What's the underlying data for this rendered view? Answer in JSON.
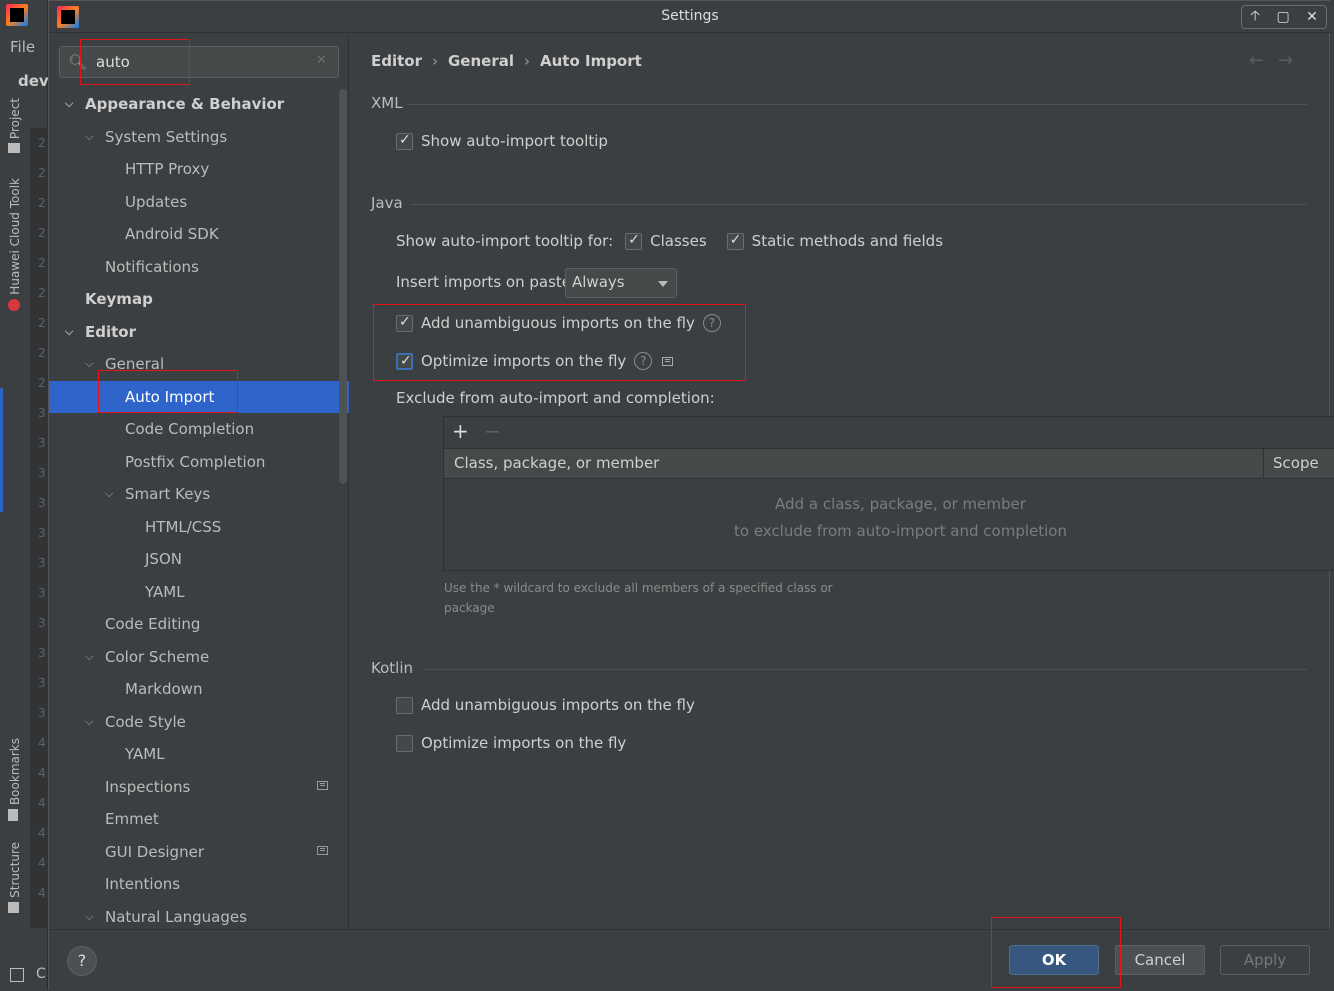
{
  "ide": {
    "menu_file": "File",
    "project_label": "devl",
    "side_tabs": [
      "Project",
      "Huawei Cloud Toolk",
      "Bookmarks",
      "Structure"
    ],
    "gutter_numbers": [
      "2",
      "2",
      "2",
      "2",
      "2",
      "2",
      "2",
      "2",
      "2",
      "3",
      "3",
      "3",
      "3",
      "3",
      "3",
      "3",
      "3",
      "3",
      "3",
      "3",
      "4",
      "4",
      "4",
      "4",
      "4",
      "4"
    ],
    "bottom_label": "C"
  },
  "dialog": {
    "title": "Settings",
    "window_controls": [
      "🡡",
      "▢",
      "✕"
    ]
  },
  "search": {
    "value": "auto",
    "clear": "✕"
  },
  "tree": [
    {
      "label": "Appearance & Behavior",
      "level": 0,
      "expanded": true,
      "bold": true
    },
    {
      "label": "System Settings",
      "level": 1,
      "expanded": true
    },
    {
      "label": "HTTP Proxy",
      "level": 2
    },
    {
      "label": "Updates",
      "level": 2
    },
    {
      "label": "Android SDK",
      "level": 2
    },
    {
      "label": "Notifications",
      "level": 1
    },
    {
      "label": "Keymap",
      "level": 0,
      "bold": true
    },
    {
      "label": "Editor",
      "level": 0,
      "expanded": true,
      "bold": true
    },
    {
      "label": "General",
      "level": 1,
      "expanded": true
    },
    {
      "label": "Auto Import",
      "level": 2,
      "selected": true
    },
    {
      "label": "Code Completion",
      "level": 2
    },
    {
      "label": "Postfix Completion",
      "level": 2
    },
    {
      "label": "Smart Keys",
      "level": 2,
      "expanded": true
    },
    {
      "label": "HTML/CSS",
      "level": 3
    },
    {
      "label": "JSON",
      "level": 3
    },
    {
      "label": "YAML",
      "level": 3
    },
    {
      "label": "Code Editing",
      "level": 1
    },
    {
      "label": "Color Scheme",
      "level": 1,
      "expanded": true
    },
    {
      "label": "Markdown",
      "level": 2
    },
    {
      "label": "Code Style",
      "level": 1,
      "expanded": true
    },
    {
      "label": "YAML",
      "level": 2
    },
    {
      "label": "Inspections",
      "level": 1,
      "modified": true
    },
    {
      "label": "Emmet",
      "level": 1
    },
    {
      "label": "GUI Designer",
      "level": 1,
      "modified": true
    },
    {
      "label": "Intentions",
      "level": 1
    },
    {
      "label": "Natural Languages",
      "level": 1,
      "expanded": true
    }
  ],
  "breadcrumb": [
    "Editor",
    "General",
    "Auto Import"
  ],
  "breadcrumb_sep": "›",
  "nav": {
    "back": "←",
    "forward": "→"
  },
  "xml": {
    "title": "XML",
    "show_tooltip": {
      "label": "Show auto-import tooltip",
      "checked": true
    }
  },
  "java": {
    "title": "Java",
    "tooltip_for_label": "Show auto-import tooltip for:",
    "classes": {
      "label": "Classes",
      "checked": true
    },
    "static_methods": {
      "label": "Static methods and fields",
      "checked": true
    },
    "insert_label": "Insert imports on paste:",
    "insert_value": "Always",
    "add_unambiguous": {
      "label": "Add unambiguous imports on the fly",
      "checked": true
    },
    "optimize": {
      "label": "Optimize imports on the fly",
      "checked": true
    },
    "exclude_label": "Exclude from auto-import and completion:",
    "add_btn": "+",
    "remove_btn": "−",
    "col_class": "Class, package, or member",
    "col_scope": "Scope",
    "empty_line1": "Add a class, package, or member",
    "empty_line2": "to exclude from auto-import and completion",
    "hint_line1": "Use the * wildcard to exclude all members of a specified class or",
    "hint_line2": "package"
  },
  "kotlin": {
    "title": "Kotlin",
    "add_unambiguous": {
      "label": "Add unambiguous imports on the fly",
      "checked": false
    },
    "optimize": {
      "label": "Optimize imports on the fly",
      "checked": false
    }
  },
  "footer": {
    "help": "?",
    "ok": "OK",
    "cancel": "Cancel",
    "apply": "Apply"
  },
  "colors": {
    "selection": "#2f65ca",
    "ok_button": "#365880",
    "annotation": "#e0161b"
  }
}
